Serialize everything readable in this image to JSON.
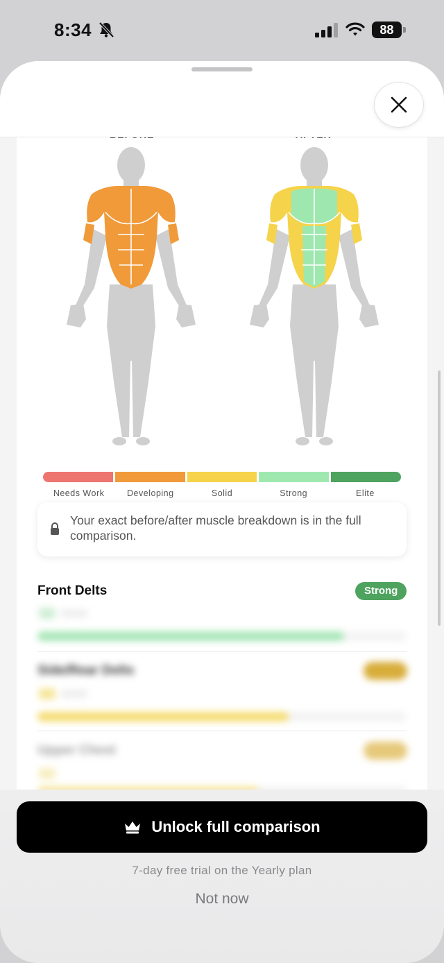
{
  "status": {
    "time": "8:34",
    "battery": "88"
  },
  "comparison": {
    "before_label": "BEFORE",
    "after_label": "AFTER"
  },
  "colors": {
    "needs_work": "#ee7470",
    "developing": "#f09a3a",
    "solid": "#f5d34a",
    "strong": "#9ee8b0",
    "elite": "#4ea35e",
    "body": "#cfcfcf"
  },
  "scale": {
    "levels": [
      "Needs Work",
      "Developing",
      "Solid",
      "Strong",
      "Elite"
    ]
  },
  "lock_note": "Your exact before/after muscle breakdown is in the full comparison.",
  "muscles": [
    {
      "name": "Front Delts",
      "level": "Strong",
      "fill": 0.83
    },
    {
      "name": "Side/Rear Delts",
      "level": "Solid",
      "fill": 0.68
    },
    {
      "name": "Upper Chest",
      "level": "Solid",
      "fill": 0.6
    }
  ],
  "cta": {
    "label": "Unlock full comparison",
    "icon": "crown-icon"
  },
  "trial_note": "7-day free trial on the Yearly plan",
  "dismiss": "Not now"
}
